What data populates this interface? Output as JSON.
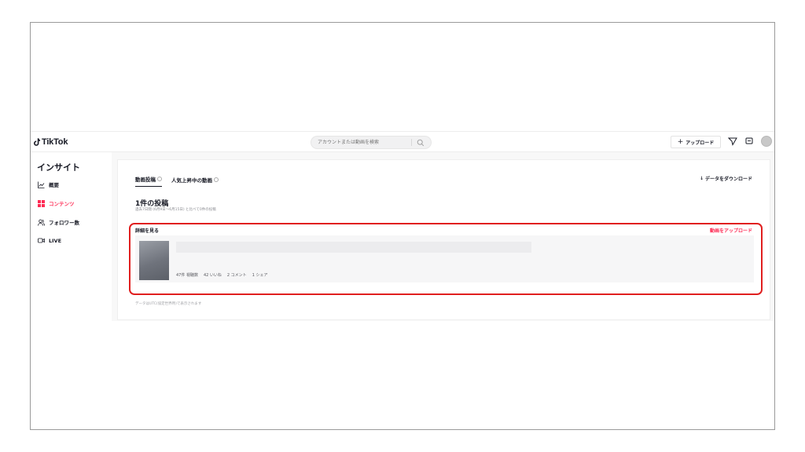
{
  "header": {
    "logo_text": "TikTok",
    "search_placeholder": "アカウントまたは動画を検索",
    "upload_label": "アップロード",
    "icons": [
      "search-icon",
      "send-icon",
      "inbox-icon"
    ]
  },
  "sidebar": {
    "title": "インサイト",
    "items": [
      {
        "label": "概要",
        "icon": "chart-line-icon",
        "active": false
      },
      {
        "label": "コンテンツ",
        "icon": "grid-icon",
        "active": true
      },
      {
        "label": "フォロワー数",
        "icon": "followers-icon",
        "active": false
      },
      {
        "label": "LIVE",
        "icon": "live-icon",
        "active": false
      }
    ]
  },
  "main": {
    "tabs": [
      {
        "label": "動画投稿",
        "active": true
      },
      {
        "label": "人気上昇中の動画",
        "active": false
      }
    ],
    "download_label": "データをダウンロード",
    "posts_count": "1件の投稿",
    "posts_sub": "過去7日間 (6月9日〜6月15日) と比べて0件の投稿",
    "detail_label": "詳細を見る",
    "upload_video_label": "動画をアップロード",
    "video": {
      "views": "47件 視聴数",
      "likes": "42 いいね",
      "comments": "2 コメント",
      "shares": "1 シェア"
    },
    "footer_note": "データはUTC(協定世界時)で表示されます"
  },
  "colors": {
    "accent": "#fe2c55",
    "highlight": "#e01f1f"
  }
}
